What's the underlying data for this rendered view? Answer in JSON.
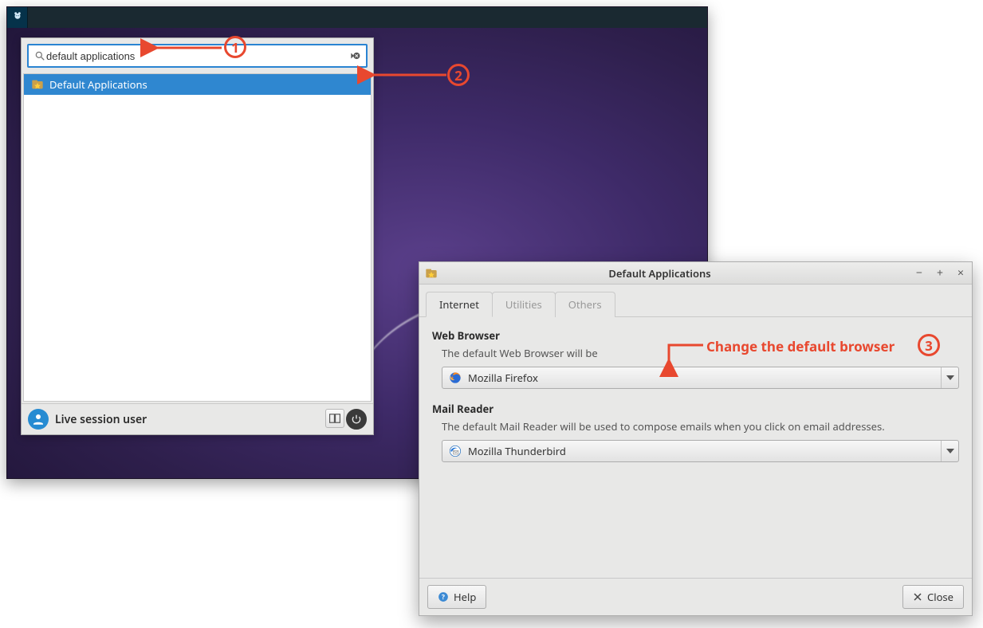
{
  "launcher": {
    "search_value": "default applications",
    "result_label": "Default Applications",
    "user_label": "Live session user"
  },
  "dialog": {
    "title": "Default Applications",
    "tabs": {
      "t0": "Internet",
      "t1": "Utilities",
      "t2": "Others"
    },
    "web_browser": {
      "title": "Web Browser",
      "desc": "The default Web Browser will be",
      "value": "Mozilla Firefox"
    },
    "mail_reader": {
      "title": "Mail Reader",
      "desc": "The default Mail Reader will be used to compose emails when you click on email addresses.",
      "value": "Mozilla Thunderbird"
    },
    "help_label": "Help",
    "close_label": "Close"
  },
  "annotations": {
    "n1": "1",
    "n2": "2",
    "n3": "3",
    "label3": "Change the default browser"
  }
}
